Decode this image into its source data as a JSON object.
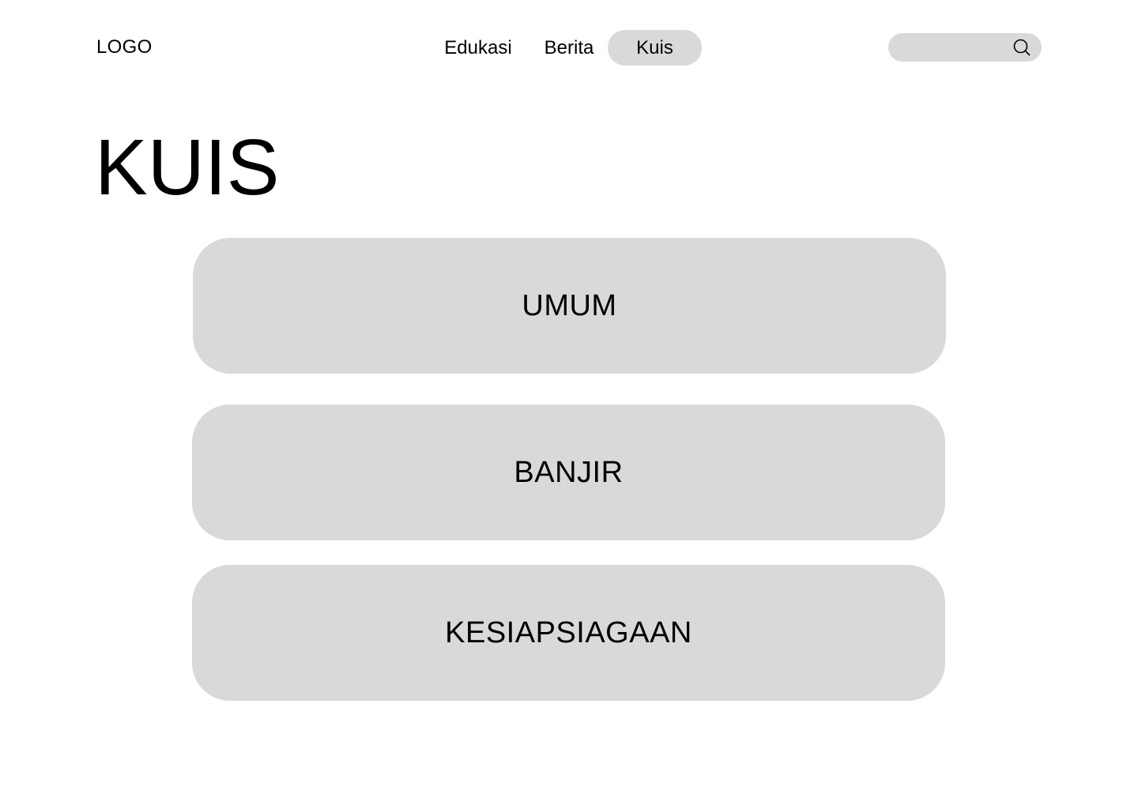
{
  "header": {
    "logo": "LOGO",
    "nav": {
      "edukasi": "Edukasi",
      "berita": "Berita",
      "kuis": "Kuis",
      "active": "Kuis"
    },
    "search": {
      "value": "",
      "placeholder": "",
      "icon": "search-icon"
    }
  },
  "main": {
    "title": "KUIS",
    "categories": [
      {
        "label": "UMUM"
      },
      {
        "label": "BANJIR"
      },
      {
        "label": "KESIAPSIAGAAN"
      }
    ]
  },
  "colors": {
    "surface": "#d9d9d9",
    "background": "#ffffff",
    "text": "#000000"
  }
}
